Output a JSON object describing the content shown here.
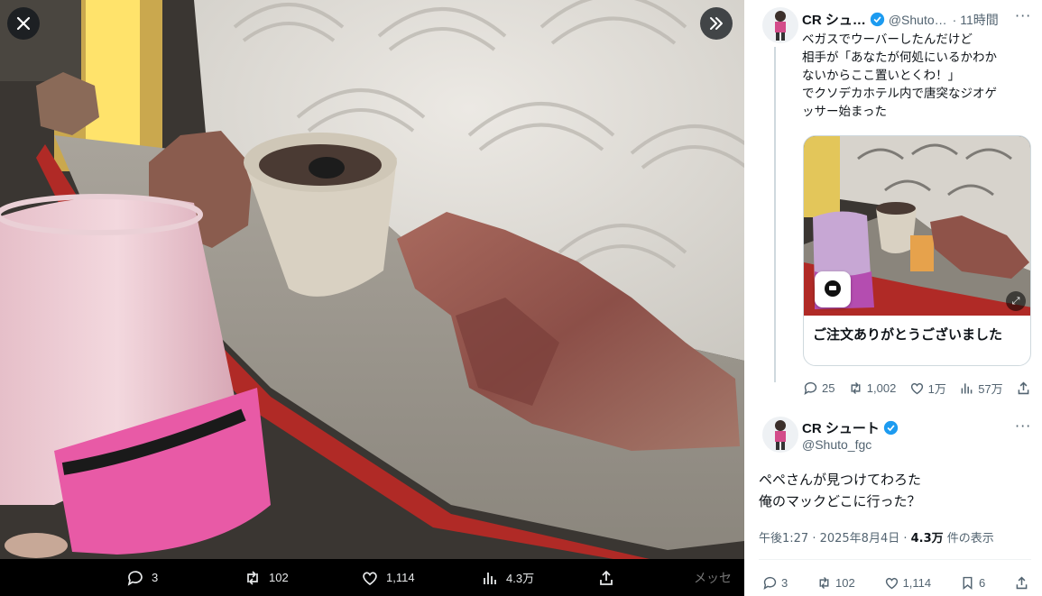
{
  "viewer": {
    "icons": {
      "close": "close-icon",
      "collapse": "chevron-double-right-icon"
    },
    "actions": {
      "reply_count": "3",
      "retweet_count": "102",
      "like_count": "1,114",
      "views_count": "4.3万"
    },
    "edge_text": "メッセ"
  },
  "quoted_tweet": {
    "name": "CR シュ…",
    "handle": "@Shuto…",
    "time": "· 11時間",
    "text": "ベガスでウーバーしたんだけど\n相手が「あなたが何処にいるかわか\nないからここ置いとくわ！」\nでクソデカホテル内で唐突なジオゲ\nッサー始まった",
    "card_title": "ご注文ありがとうございました",
    "stats": {
      "replies": "25",
      "retweets": "1,002",
      "likes": "1万",
      "views": "57万"
    }
  },
  "main_tweet": {
    "name": "CR シュート",
    "handle": "@Shuto_fgc",
    "text": "ペペさんが見つけてわろた\n俺のマックどこに行った？",
    "time": "午後1:27 · 2025年8月4日 · ",
    "views_value": "4.3万",
    "views_suffix": " 件の表示",
    "stats": {
      "replies": "3",
      "retweets": "102",
      "likes": "1,114",
      "bookmarks": "6"
    }
  },
  "colors": {
    "verified": "#1d9bf0",
    "text_secondary": "#536471",
    "accent_pink": "#e85aa6"
  }
}
